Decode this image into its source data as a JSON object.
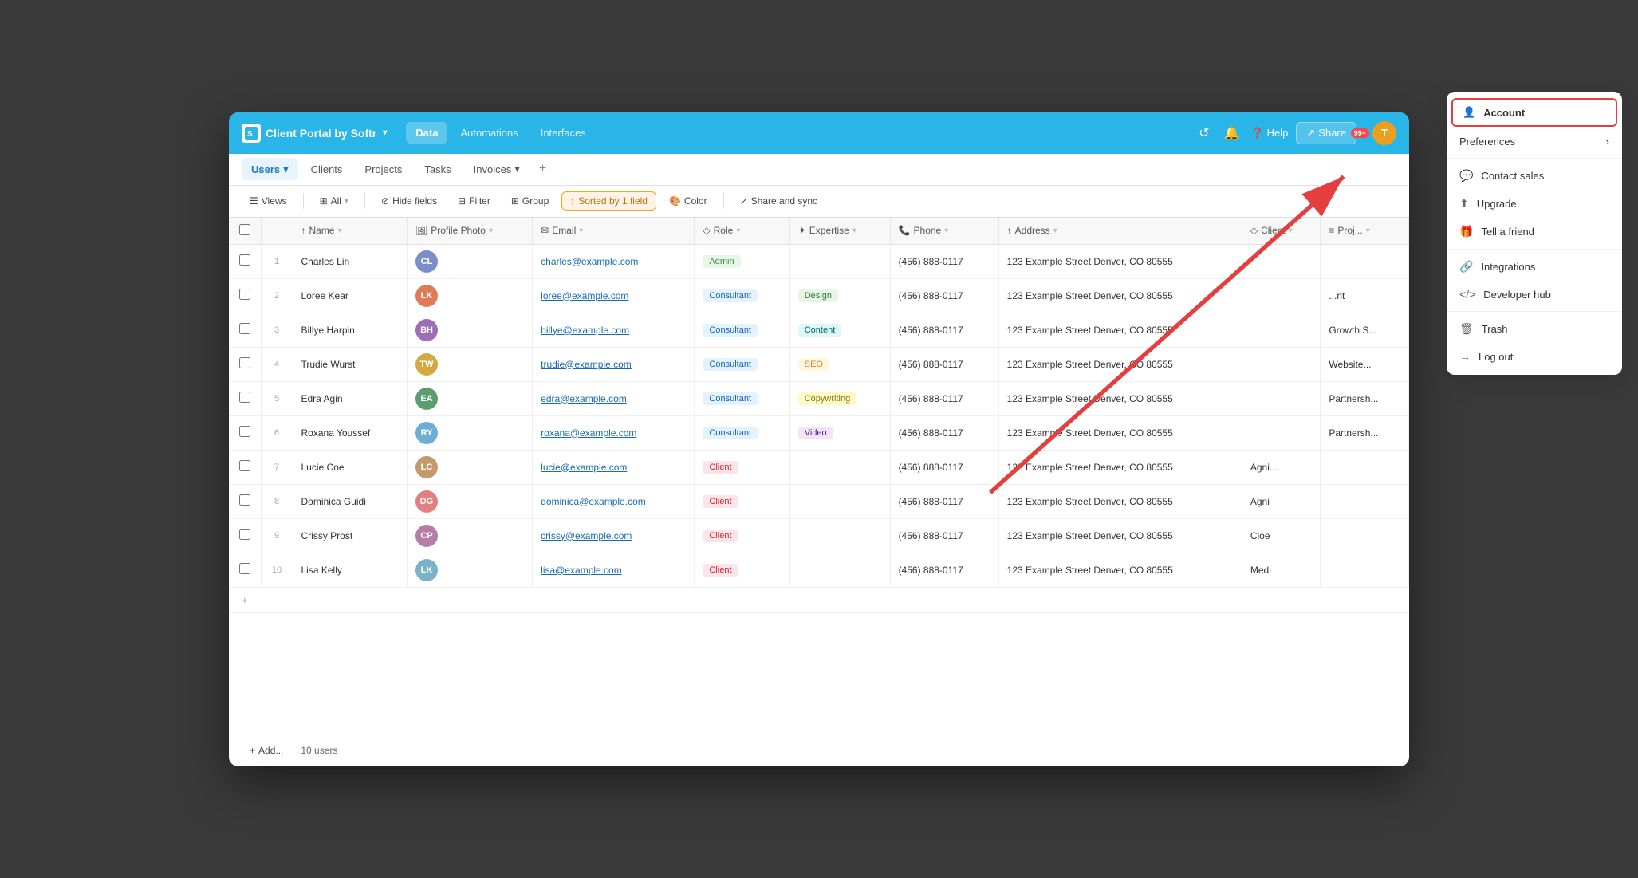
{
  "app": {
    "title": "Client Portal by Softr",
    "logo_letter": "S"
  },
  "top_nav": {
    "items": [
      {
        "label": "Data",
        "active": true
      },
      {
        "label": "Automations",
        "active": false
      },
      {
        "label": "Interfaces",
        "active": false
      }
    ],
    "help": "Help",
    "share": "Share",
    "notification_count": "99+",
    "avatar_letter": "T"
  },
  "tabs": [
    {
      "label": "Users",
      "active": true,
      "has_dropdown": true
    },
    {
      "label": "Clients",
      "active": false
    },
    {
      "label": "Projects",
      "active": false
    },
    {
      "label": "Tasks",
      "active": false
    },
    {
      "label": "Invoices",
      "active": false,
      "has_dropdown": true
    }
  ],
  "toolbar": {
    "views_label": "Views",
    "all_label": "All",
    "hide_fields": "Hide fields",
    "filter": "Filter",
    "group": "Group",
    "sorted_by": "Sorted by 1 field",
    "color": "Color",
    "share_sync": "Share and sync"
  },
  "table": {
    "columns": [
      {
        "label": "",
        "icon": ""
      },
      {
        "label": "",
        "icon": ""
      },
      {
        "label": "Name",
        "icon": "↑"
      },
      {
        "label": "Profile Photo",
        "icon": "🖼"
      },
      {
        "label": "Email",
        "icon": "✉"
      },
      {
        "label": "Role",
        "icon": "◇"
      },
      {
        "label": "Expertise",
        "icon": "✦"
      },
      {
        "label": "Phone",
        "icon": "📞"
      },
      {
        "label": "Address",
        "icon": "↑"
      },
      {
        "label": "Client",
        "icon": "◇"
      },
      {
        "label": "Proj...",
        "icon": "≡"
      }
    ],
    "rows": [
      {
        "num": 1,
        "name": "Charles Lin",
        "photo_color": "#7b8ec8",
        "photo_initials": "CL",
        "email": "charles@example.com",
        "role": "Admin",
        "role_type": "admin",
        "expertise": "",
        "phone": "(456) 888-0117",
        "address": "123 Example Street Denver, CO 80555",
        "client": "",
        "project": ""
      },
      {
        "num": 2,
        "name": "Loree Kear",
        "photo_color": "#e07b5a",
        "photo_initials": "LK",
        "email": "loree@example.com",
        "role": "Consultant",
        "role_type": "consultant",
        "expertise": "Design",
        "expertise_type": "design",
        "phone": "(456) 888-0117",
        "address": "123 Example Street Denver, CO 80555",
        "client": "",
        "project": "...nt"
      },
      {
        "num": 3,
        "name": "Billye Harpin",
        "photo_color": "#9c6eb5",
        "photo_initials": "BH",
        "email": "billye@example.com",
        "role": "Consultant",
        "role_type": "consultant",
        "expertise": "Content",
        "expertise_type": "content",
        "phone": "(456) 888-0117",
        "address": "123 Example Street Denver, CO 80555",
        "client": "",
        "project": "Growth S..."
      },
      {
        "num": 4,
        "name": "Trudie Wurst",
        "photo_color": "#d4a843",
        "photo_initials": "TW",
        "email": "trudie@example.com",
        "role": "Consultant",
        "role_type": "consultant",
        "expertise": "SEO",
        "expertise_type": "seo",
        "phone": "(456) 888-0117",
        "address": "123 Example Street Denver, CO 80555",
        "client": "",
        "project": "Website..."
      },
      {
        "num": 5,
        "name": "Edra Agin",
        "photo_color": "#5a9e6f",
        "photo_initials": "EA",
        "email": "edra@example.com",
        "role": "Consultant",
        "role_type": "consultant",
        "expertise": "Copywriting",
        "expertise_type": "copywriting",
        "phone": "(456) 888-0117",
        "address": "123 Example Street Denver, CO 80555",
        "client": "",
        "project": "Partnersh..."
      },
      {
        "num": 6,
        "name": "Roxana Youssef",
        "photo_color": "#6baed6",
        "photo_initials": "RY",
        "email": "roxana@example.com",
        "role": "Consultant",
        "role_type": "consultant",
        "expertise": "Video",
        "expertise_type": "video",
        "phone": "(456) 888-0117",
        "address": "123 Example Street Denver, CO 80555",
        "client": "",
        "project": "Partnersh..."
      },
      {
        "num": 7,
        "name": "Lucie Coe",
        "photo_color": "#c49a6c",
        "photo_initials": "LC",
        "email": "lucie@example.com",
        "role": "Client",
        "role_type": "client",
        "expertise": "",
        "phone": "(456) 888-0117",
        "address": "123 Example Street Denver, CO 80555",
        "client": "Agni...",
        "project": ""
      },
      {
        "num": 8,
        "name": "Dominica Guidi",
        "photo_color": "#e08080",
        "photo_initials": "DG",
        "email": "dominica@example.com",
        "role": "Client",
        "role_type": "client",
        "expertise": "",
        "phone": "(456) 888-0117",
        "address": "123 Example Street Denver, CO 80555",
        "client": "Agni",
        "project": ""
      },
      {
        "num": 9,
        "name": "Crissy Prost",
        "photo_color": "#b87caa",
        "photo_initials": "CP",
        "email": "crissy@example.com",
        "role": "Client",
        "role_type": "client",
        "expertise": "",
        "phone": "(456) 888-0117",
        "address": "123 Example Street Denver, CO 80555",
        "client": "Cloe",
        "project": ""
      },
      {
        "num": 10,
        "name": "Lisa Kelly",
        "photo_color": "#7ab3c8",
        "photo_initials": "LK",
        "email": "lisa@example.com",
        "role": "Client",
        "role_type": "client",
        "expertise": "",
        "phone": "(456) 888-0117",
        "address": "123 Example Street Denver, CO 80555",
        "client": "Medi",
        "project": ""
      }
    ],
    "row_count": "10 users"
  },
  "dropdown_menu": {
    "account": "Account",
    "preferences": "Preferences",
    "contact_sales": "Contact sales",
    "upgrade": "Upgrade",
    "tell_a_friend": "Tell a friend",
    "integrations": "Integrations",
    "developer_hub": "Developer hub",
    "trash": "Trash",
    "log_out": "Log out"
  },
  "bottom": {
    "add_label": "Add...",
    "row_count": "10 users"
  }
}
